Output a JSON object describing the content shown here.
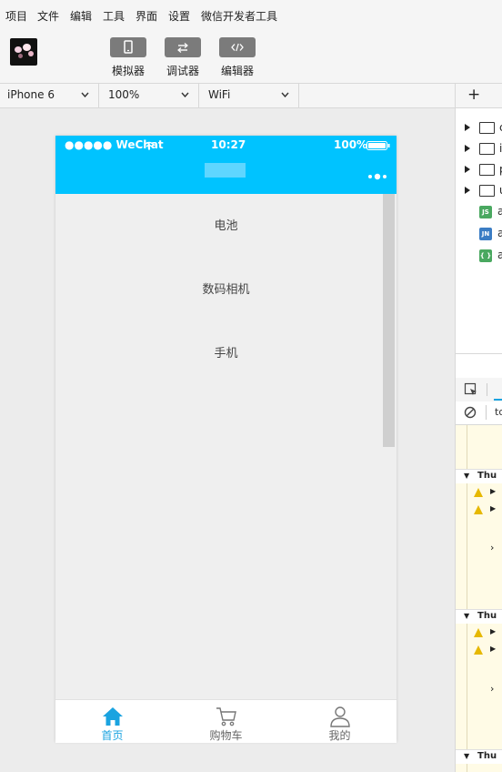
{
  "menu": [
    "项目",
    "文件",
    "编辑",
    "工具",
    "界面",
    "设置",
    "微信开发者工具"
  ],
  "toolbar": {
    "simulator_label": "模拟器",
    "debugger_label": "调试器",
    "editor_label": "编辑器"
  },
  "device_bar": {
    "device": "iPhone 6",
    "zoom": "100%",
    "network": "WiFi"
  },
  "phone": {
    "status_left": "●●●●● WeChat",
    "status_time": "10:27",
    "status_battery": "100%",
    "list_items": [
      "电池",
      "数码相机",
      "手机"
    ],
    "tabs": [
      {
        "label": "首页",
        "icon": "home-icon",
        "active": true
      },
      {
        "label": "购物车",
        "icon": "cart-icon",
        "active": false
      },
      {
        "label": "我的",
        "icon": "user-icon",
        "active": false
      }
    ],
    "accent": "#00c3ff",
    "tab_active_color": "#1aa3e0"
  },
  "right_panel": {
    "add_glyph": "+",
    "tree_partial": [
      "c",
      "i",
      "p",
      "u"
    ],
    "file_badges": [
      "JS",
      "JN",
      "{ }"
    ],
    "file_partial": [
      "a",
      "a",
      "a"
    ],
    "filter_partial": "to",
    "console_heads": [
      "Thu",
      "Thu",
      "Thu"
    ]
  }
}
